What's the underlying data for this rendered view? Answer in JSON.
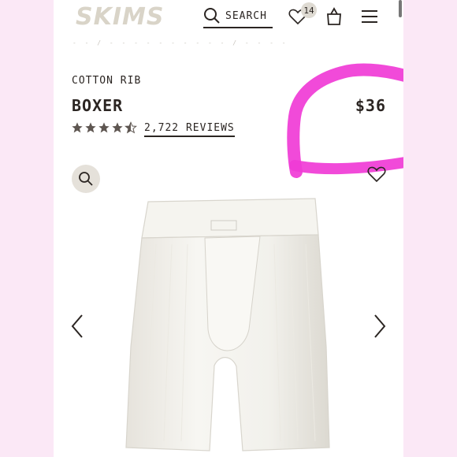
{
  "header": {
    "logo": "SKIMS",
    "search_label": "SEARCH",
    "wishlist_count": "14"
  },
  "product": {
    "collection": "COTTON RIB",
    "name": "BOXER",
    "price": "$36",
    "rating": 4.5,
    "reviews_label": "2,722 REVIEWS"
  },
  "colors": {
    "side_background": "#fbe8f6",
    "annotation": "#f03bd6",
    "text": "#2b2522",
    "logo": "#d9d4c8"
  },
  "icons": [
    "search-icon",
    "heart-icon",
    "bag-icon",
    "menu-icon",
    "zoom-icon",
    "wishlist-heart-icon",
    "chevron-left-icon",
    "chevron-right-icon"
  ]
}
